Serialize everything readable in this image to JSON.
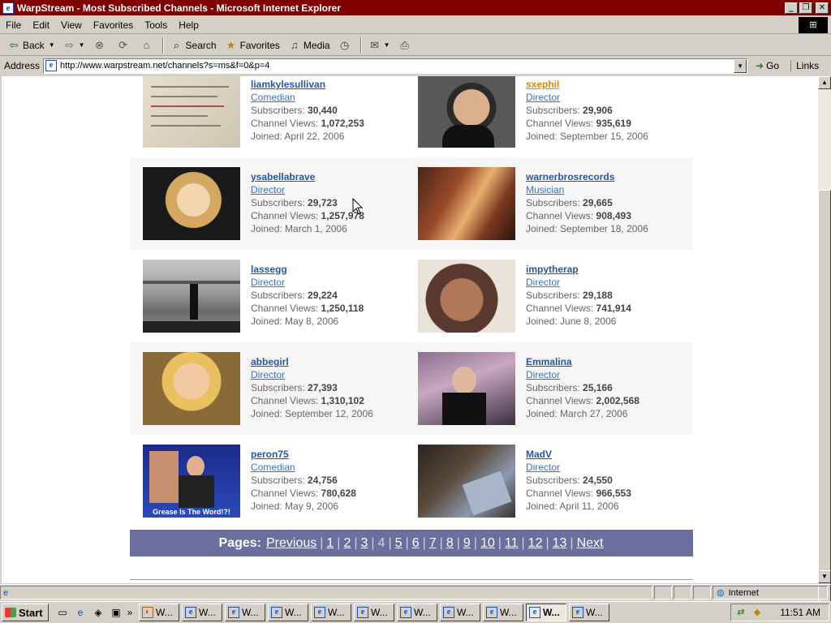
{
  "window": {
    "title": "WarpStream - Most Subscribed Channels - Microsoft Internet Explorer"
  },
  "menu": [
    "File",
    "Edit",
    "View",
    "Favorites",
    "Tools",
    "Help"
  ],
  "toolbar": {
    "back": "Back",
    "search": "Search",
    "favorites": "Favorites",
    "media": "Media"
  },
  "address": {
    "label": "Address",
    "url": "http://www.warpstream.net/channels?s=ms&f=0&p=4",
    "go": "Go",
    "links": "Links"
  },
  "labels": {
    "subscribers": "Subscribers:",
    "views": "Channel Views:",
    "joined": "Joined:"
  },
  "channels": [
    {
      "name": "liamkylesullivan",
      "category": "Comedian",
      "subscribers": "30,440",
      "views": "1,072,253",
      "joined": "April 22, 2006",
      "thumb": "handwritten-note"
    },
    {
      "name": "sxephil",
      "category": "Director",
      "subscribers": "29,906",
      "views": "935,619",
      "joined": "September 15, 2006",
      "thumb": "man-with-cap"
    },
    {
      "name": "ysabellabrave",
      "category": "Director",
      "subscribers": "29,723",
      "views": "1,257,978",
      "joined": "March 1, 2006",
      "thumb": "blonde-woman"
    },
    {
      "name": "warnerbrosrecords",
      "category": "Musician",
      "subscribers": "29,665",
      "views": "908,493",
      "joined": "September 18, 2006",
      "thumb": "music-video-still"
    },
    {
      "name": "lassegg",
      "category": "Director",
      "subscribers": "29,224",
      "views": "1,250,118",
      "joined": "May 8, 2006",
      "thumb": "man-walking-street"
    },
    {
      "name": "impytherap",
      "category": "Director",
      "subscribers": "29,188",
      "views": "741,914",
      "joined": "June 8, 2006",
      "thumb": "group-on-couch"
    },
    {
      "name": "abbegirl",
      "category": "Director",
      "subscribers": "27,393",
      "views": "1,310,102",
      "joined": "September 12, 2006",
      "thumb": "smiling-woman"
    },
    {
      "name": "Emmalina",
      "category": "Director",
      "subscribers": "25,166",
      "views": "2,002,568",
      "joined": "March 27, 2006",
      "thumb": "woman-in-room"
    },
    {
      "name": "peron75",
      "category": "Comedian",
      "subscribers": "24,756",
      "views": "780,628",
      "joined": "May 9, 2006",
      "thumb": "news-anchor",
      "caption": "Grease Is The Word!?!"
    },
    {
      "name": "MadV",
      "category": "Director",
      "subscribers": "24,550",
      "views": "966,553",
      "joined": "April 11, 2006",
      "thumb": "hand-with-writing"
    }
  ],
  "pagination": {
    "label": "Pages:",
    "previous": "Previous",
    "pages": [
      "1",
      "2",
      "3",
      "4",
      "5",
      "6",
      "7",
      "8",
      "9",
      "10",
      "11",
      "12",
      "13"
    ],
    "current": "4",
    "next": "Next"
  },
  "status": {
    "zone": "Internet"
  },
  "taskbar": {
    "start": "Start",
    "clock": "11:51 AM",
    "task_label": "W..."
  }
}
